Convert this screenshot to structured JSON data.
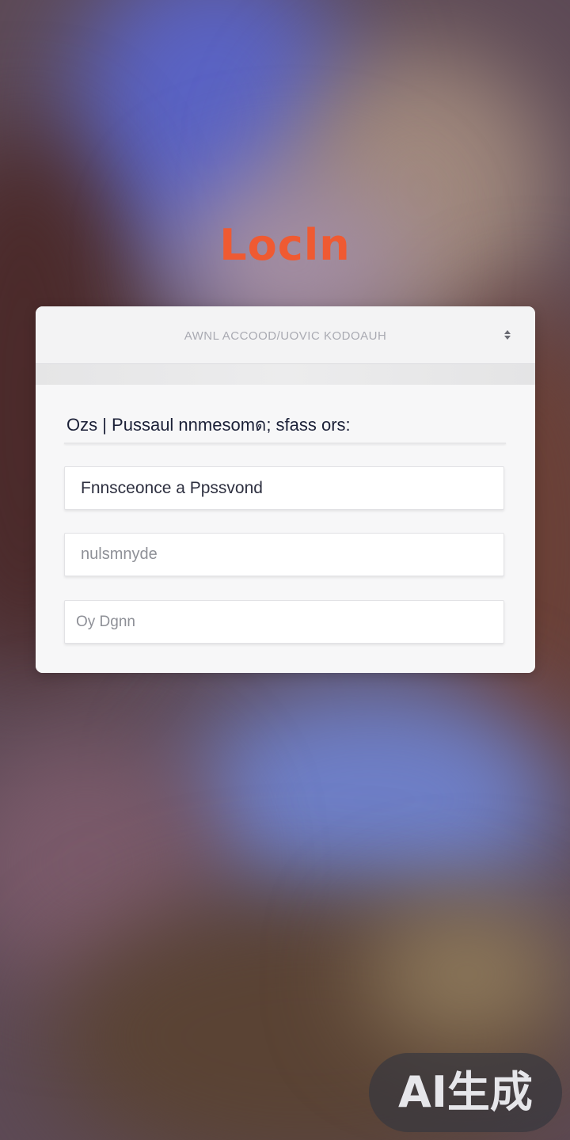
{
  "page": {
    "title": "Locln"
  },
  "card": {
    "header_title": "AWNL ACCOOD/UOVIC KODOAUH",
    "header_icon": "settings-icon",
    "instruction": "Ozs | Pussaul nnmesomด; sfass ors:",
    "fields": [
      {
        "placeholder": "Fnnsceonce a Ppssvond"
      },
      {
        "placeholder": "nulsmnyde"
      },
      {
        "placeholder": "Oy Dgnn"
      }
    ]
  },
  "watermark": {
    "text": "AI生成"
  },
  "colors": {
    "title": "#ef5a32",
    "card_bg": "#f6f6f7",
    "text_dark": "#1c2138"
  }
}
